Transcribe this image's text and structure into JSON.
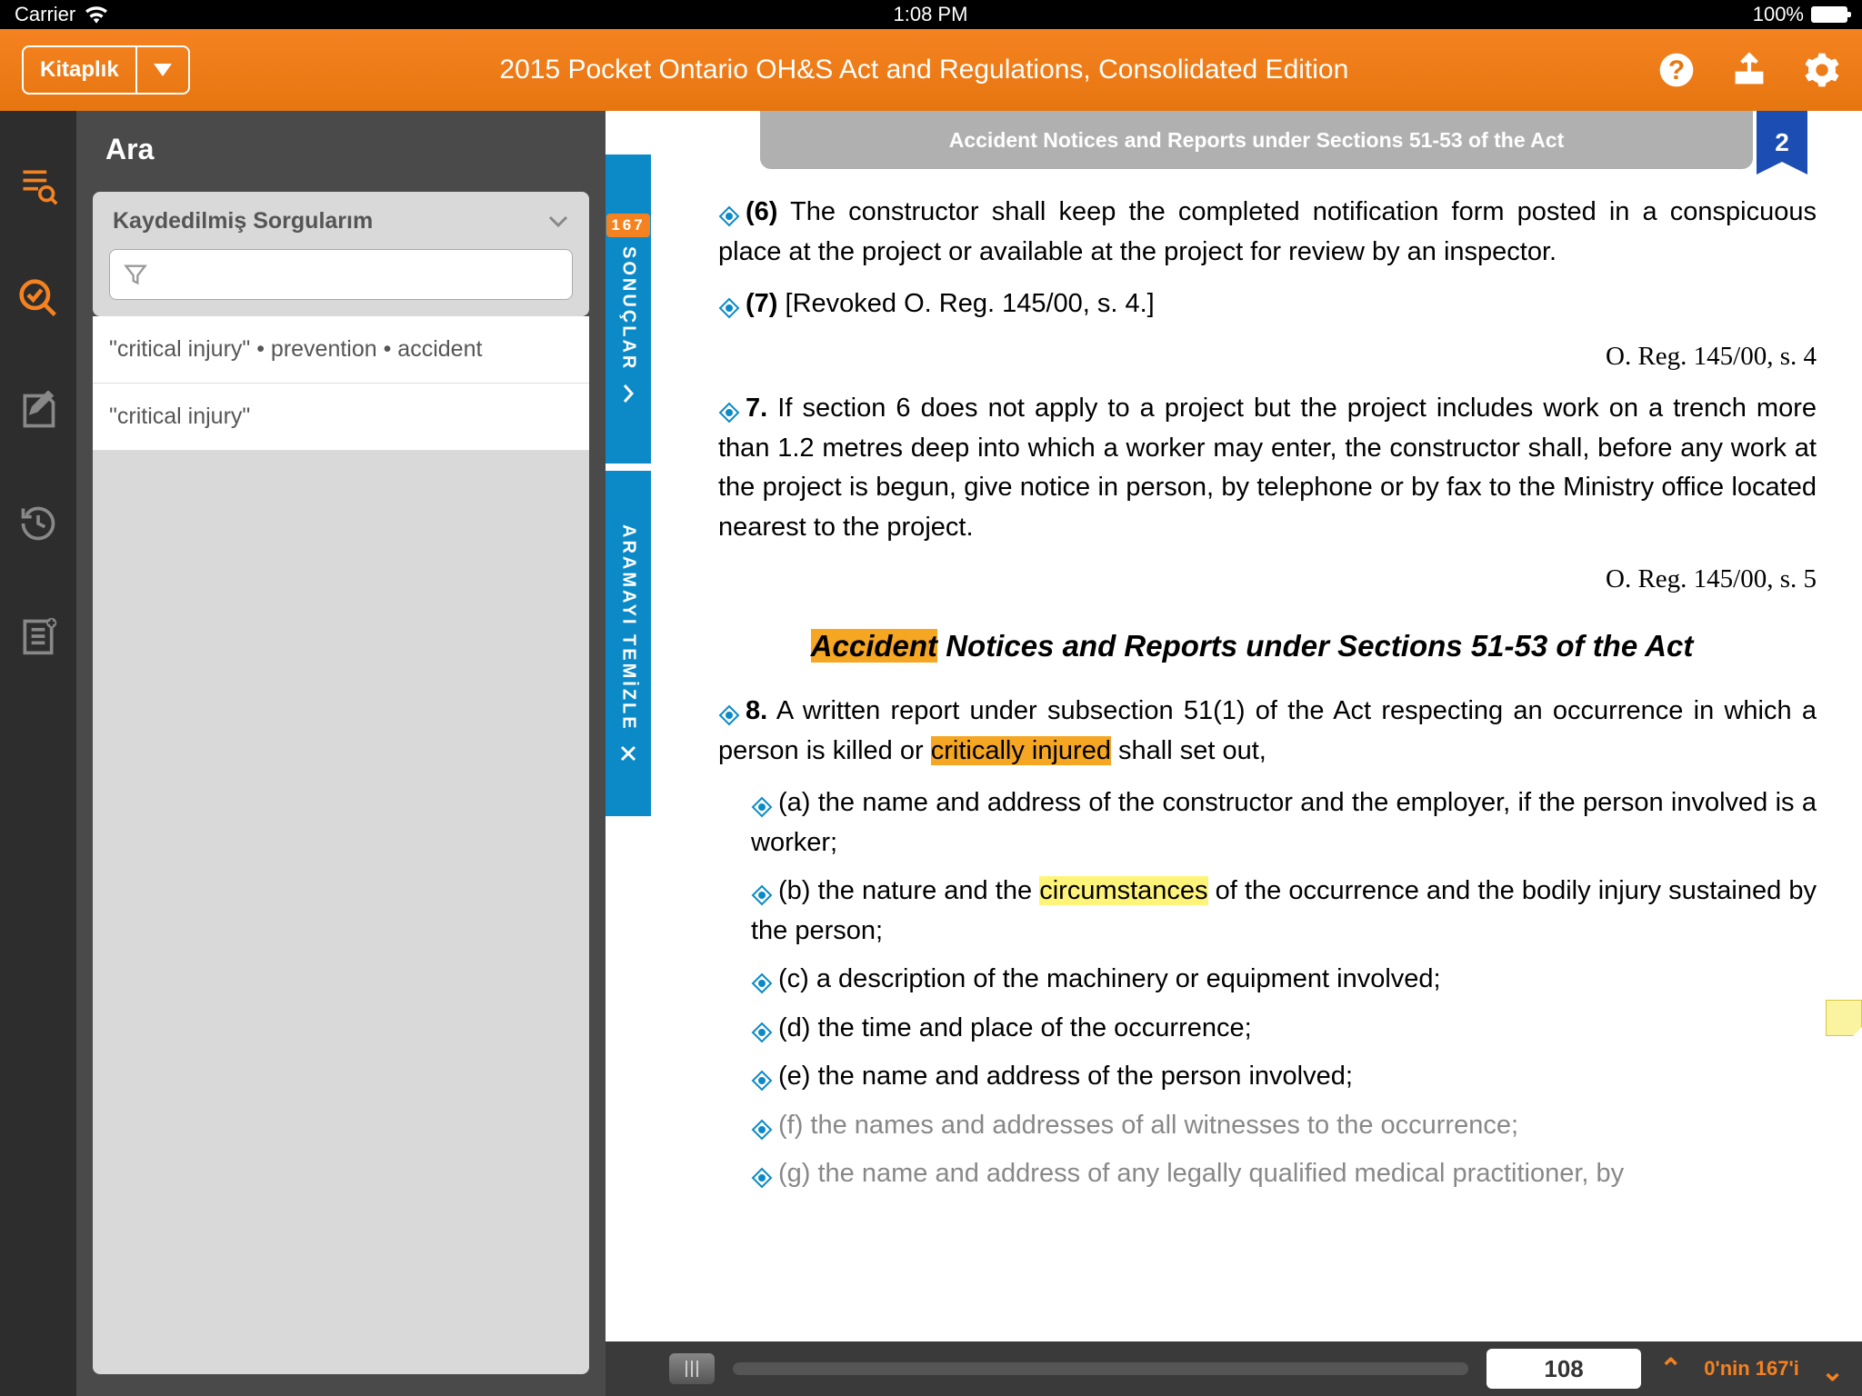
{
  "status": {
    "carrier": "Carrier",
    "time": "1:08 PM",
    "battery": "100%"
  },
  "topbar": {
    "library": "Kitaplık",
    "title": "2015 Pocket Ontario OH&S Act and Regulations, Consolidated Edition"
  },
  "search": {
    "panel_title": "Ara",
    "saved_label": "Kaydedilmiş Sorgularım",
    "queries": [
      "\"critical injury\"  •  prevention  •  accident",
      "\"critical injury\""
    ]
  },
  "vtabs": {
    "badge": "167",
    "results": "SONUÇLAR",
    "clear": "ARAMAYI TEMİZLE"
  },
  "doc": {
    "header": "Accident Notices and Reports under Sections 51-53 of the Act",
    "bookmark": "2",
    "p6_lead": "(6)",
    "p6": " The constructor shall keep the completed notification form posted in a conspicuous place at the project or available at the project for review by an inspector.",
    "p7_lead": "(7)",
    "p7": " [Revoked O. Reg. 145/00, s. 4.]",
    "cite1": "O. Reg. 145/00, s. 4",
    "p7b_lead": "7.",
    "p7b": " If section 6 does not apply to a project but the project includes work on a trench more than 1.2 metres deep into which a worker may enter, the constructor shall, before any work at the project is begun, give notice in person, by telephone or by fax to the Ministry office located nearest to the project.",
    "cite2": "O. Reg. 145/00, s. 5",
    "heading_hl": "Accident",
    "heading_rest": " Notices and Reports under Sections 51-53 of the Act",
    "p8_lead": "8.",
    "p8_a": " A written report under subsection 51(1) of the Act respecting an occurrence in which a person is killed or ",
    "p8_hl": "critically injured",
    "p8_b": " shall set out,",
    "sa": "(a) the name and address of the constructor and the employer, if the person involved is a worker;",
    "sb_a": "(b) the nature and the ",
    "sb_hl": "circumstances",
    "sb_b": " of the occurrence and the bodily injury sustained by the person;",
    "sc": "(c) a description of the machinery or equipment involved;",
    "sd": "(d) the time and place of the occurrence;",
    "se": "(e) the name and address of the person involved;",
    "sf": "(f) the names and addresses of all witnesses to the occurrence;",
    "sg": "(g) the name and address of any legally qualified medical practitioner, by"
  },
  "footer": {
    "page": "108",
    "range": "0'nin 167'i"
  }
}
